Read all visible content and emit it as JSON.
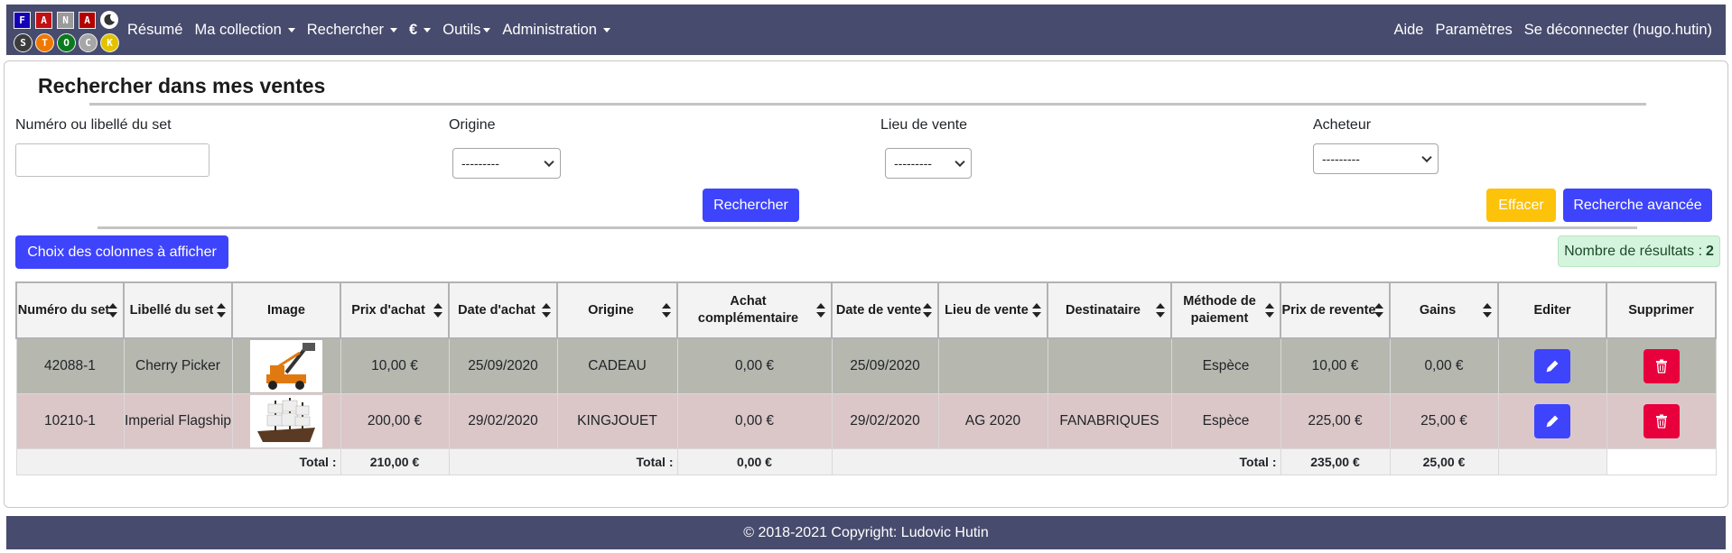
{
  "logo": {
    "tiles": [
      {
        "letter": "F",
        "bg": "#1400b8"
      },
      {
        "letter": "A",
        "bg": "#c21015"
      },
      {
        "letter": "N",
        "bg": "#9a9a9a"
      },
      {
        "letter": "A",
        "bg": "#b30000"
      },
      {
        "letter": "S",
        "bg": "#3c3c3c"
      },
      {
        "letter": "T",
        "bg": "#f07800"
      },
      {
        "letter": "O",
        "bg": "#0a7a1e"
      },
      {
        "letter": "C",
        "bg": "#a6a6a6"
      },
      {
        "letter": "K",
        "bg": "#e2c300"
      }
    ]
  },
  "nav": {
    "resume": "Résumé",
    "collection": "Ma collection",
    "search": "Rechercher",
    "euro": "€",
    "tools": "Outils",
    "admin": "Administration",
    "help": "Aide",
    "settings": "Paramètres",
    "logout": "Se déconnecter (hugo.hutin)"
  },
  "page": {
    "title": "Rechercher dans mes ventes"
  },
  "filters": {
    "set_label": "Numéro ou libellé du set",
    "set_value": "",
    "origin_label": "Origine",
    "origin_value": "---------",
    "place_label": "Lieu de vente",
    "place_value": "---------",
    "buyer_label": "Acheteur",
    "buyer_value": "---------"
  },
  "buttons": {
    "search": "Rechercher",
    "clear": "Effacer",
    "advanced": "Recherche avancée",
    "columns": "Choix des colonnes à afficher"
  },
  "results": {
    "label": "Nombre de résultats :",
    "count": "2"
  },
  "table": {
    "headers": {
      "set_number": "Numéro du set",
      "set_name": "Libellé du set",
      "image": "Image",
      "purchase_price": "Prix d'achat",
      "purchase_date": "Date d'achat",
      "origin": "Origine",
      "extra_purchase": "Achat complémentaire",
      "sale_date": "Date de vente",
      "sale_place": "Lieu de vente",
      "recipient": "Destinataire",
      "payment": "Méthode de paiement",
      "resale_price": "Prix de revente",
      "gains": "Gains",
      "edit": "Editer",
      "delete": "Supprimer"
    },
    "rows": [
      {
        "set_number": "42088-1",
        "set_name": "Cherry Picker",
        "purchase_price": "10,00 €",
        "purchase_date": "25/09/2020",
        "origin": "CADEAU",
        "extra_purchase": "0,00 €",
        "sale_date": "25/09/2020",
        "sale_place": "",
        "recipient": "",
        "payment": "Espèce",
        "resale_price": "10,00 €",
        "gains": "0,00 €",
        "image_icon": "cherry-picker-image"
      },
      {
        "set_number": "10210-1",
        "set_name": "Imperial Flagship",
        "purchase_price": "200,00 €",
        "purchase_date": "29/02/2020",
        "origin": "KINGJOUET",
        "extra_purchase": "0,00 €",
        "sale_date": "29/02/2020",
        "sale_place": "AG 2020",
        "recipient": "FANABRIQUES",
        "payment": "Espèce",
        "resale_price": "225,00 €",
        "gains": "25,00 €",
        "image_icon": "imperial-flagship-image"
      }
    ],
    "totals": {
      "label1": "Total :",
      "purchase_total": "210,00 €",
      "label2": "Total :",
      "extra_total": "0,00 €",
      "label3": "Total :",
      "resale_total": "235,00 €",
      "gains_total": "25,00 €"
    }
  },
  "footer": {
    "text": "© 2018-2021 Copyright: Ludovic Hutin"
  },
  "colors": {
    "navbar": "#474b6d",
    "primary": "#3e44fc",
    "warning": "#fdc20a",
    "danger": "#e8003d",
    "row_gray": "#b6b7af",
    "row_pink": "#dbc7c8",
    "badge_green": "#d5f4dd"
  }
}
